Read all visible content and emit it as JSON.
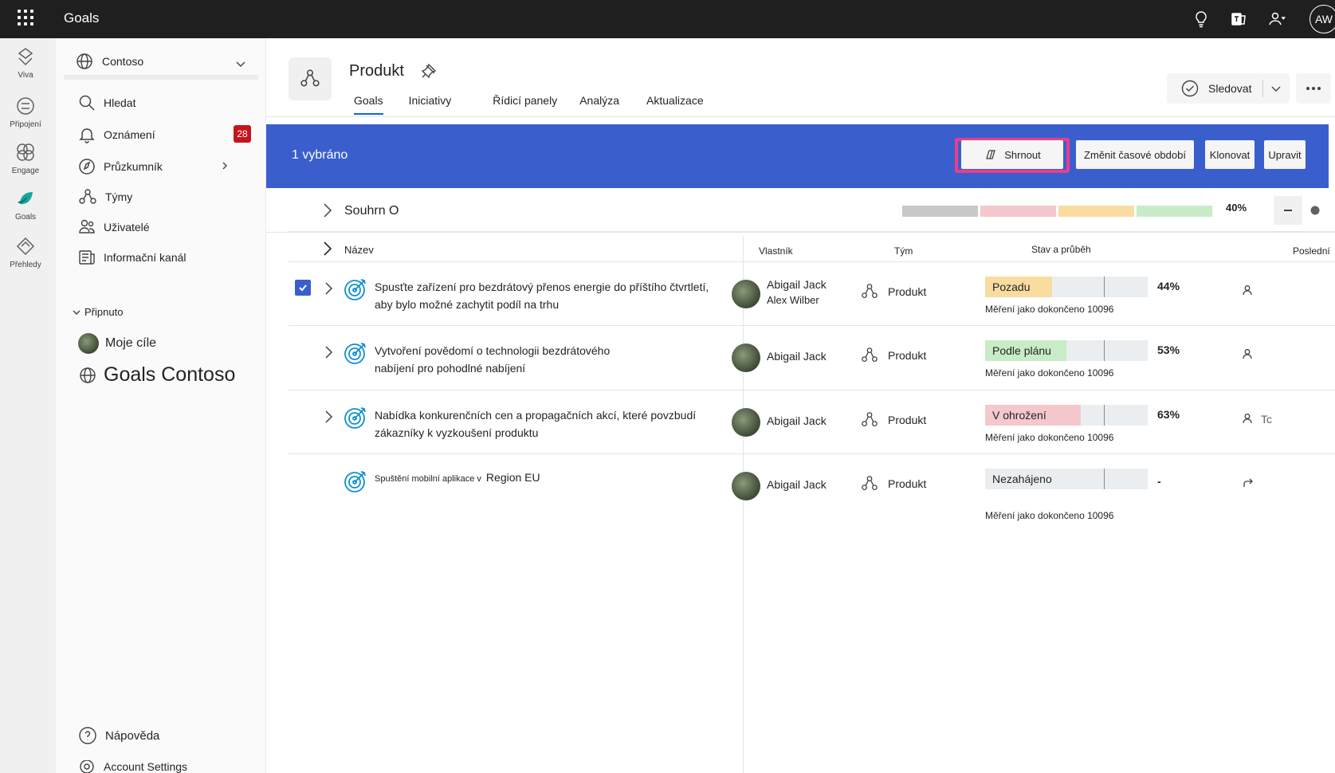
{
  "topbar": {
    "app_title": "Goals",
    "user_initials": "AW"
  },
  "rail": [
    {
      "label": "Viva",
      "icon": "viva-icon"
    },
    {
      "label": "Připojení",
      "icon": "connections-icon"
    },
    {
      "label": "Engage",
      "icon": "engage-icon"
    },
    {
      "label": "Goals",
      "icon": "goals-icon"
    },
    {
      "label": "Přehledy",
      "icon": "insights-icon"
    }
  ],
  "leftnav": {
    "org": "Contoso",
    "items": [
      {
        "label": "Hledat"
      },
      {
        "label": "Oznámení",
        "badge": "28"
      },
      {
        "label": "Průzkumník"
      },
      {
        "label": "Týmy"
      },
      {
        "label": "Uživatelé"
      },
      {
        "label": "Informační kanál"
      }
    ],
    "pinned_label": "Připnuto",
    "pinned": [
      {
        "label": "Moje cíle"
      },
      {
        "label": "Goals Contoso"
      }
    ],
    "help": "Nápověda",
    "account": "Account Settings"
  },
  "header": {
    "title": "Produkt",
    "tabs": [
      "Goals",
      "Iniciativy",
      "Řídicí panely",
      "Analýza",
      "Aktualizace"
    ],
    "follow": "Sledovat"
  },
  "selection": {
    "count": "1 vybráno",
    "buttons": [
      "Shrnout",
      "Změnit časové období",
      "Klonovat",
      "Upravit"
    ]
  },
  "summary": {
    "label": "Souhrn O",
    "pct": "40%",
    "colors": [
      "#c8c8c8",
      "#f4c8cc",
      "#f8dca0",
      "#c8ecc8"
    ]
  },
  "table": {
    "headers": [
      "Název",
      "Vlastník",
      "Tým",
      "Stav a průběh",
      "Poslední"
    ],
    "rows": [
      {
        "title1": "Spusťte zařízení pro bezdrátový přenos energie do příštího čtvrtletí,",
        "title2": "aby bylo možné zachytit podíl na trhu",
        "owner1": "Abigail Jack",
        "owner2": "Alex Wilber",
        "team": "Produkt",
        "status": "Pozadu",
        "status_color": "#f8dca0",
        "fill": 0.41,
        "pct": "44%",
        "measure": "Měření jako dokončeno 10096",
        "last": "",
        "checked": true
      },
      {
        "title1": "Vytvoření povědomí o technologii bezdrátového",
        "title2": "nabíjení pro pohodlné nabíjení",
        "owner1": "Abigail Jack",
        "owner2": "",
        "team": "Produkt",
        "status": "Podle plánu",
        "status_color": "#c8ecc8",
        "fill": 0.5,
        "pct": "53%",
        "measure": "Měření jako dokončeno 10096",
        "last": "",
        "checked": false
      },
      {
        "title1": "Nabídka konkurenčních cen a propagačních akcí, které povzbudí",
        "title2": "zákazníky k vyzkoušení produktu",
        "owner1": "Abigail Jack",
        "owner2": "",
        "team": "Produkt",
        "status": "V ohrožení",
        "status_color": "#f4c8cc",
        "fill": 0.59,
        "pct": "63%",
        "measure": "Měření jako dokončeno 10096",
        "last": "Tc",
        "checked": false
      },
      {
        "title1": "Spuštění mobilní aplikace v",
        "title2": "Region EU",
        "owner1": "Abigail Jack",
        "owner2": "",
        "team": "Produkt",
        "status": "Nezahájeno",
        "status_color": "#ebeef1",
        "fill": 0,
        "pct": "-",
        "measure": "Měření jako dokončeno 10096",
        "last": "",
        "checked": false
      }
    ]
  }
}
